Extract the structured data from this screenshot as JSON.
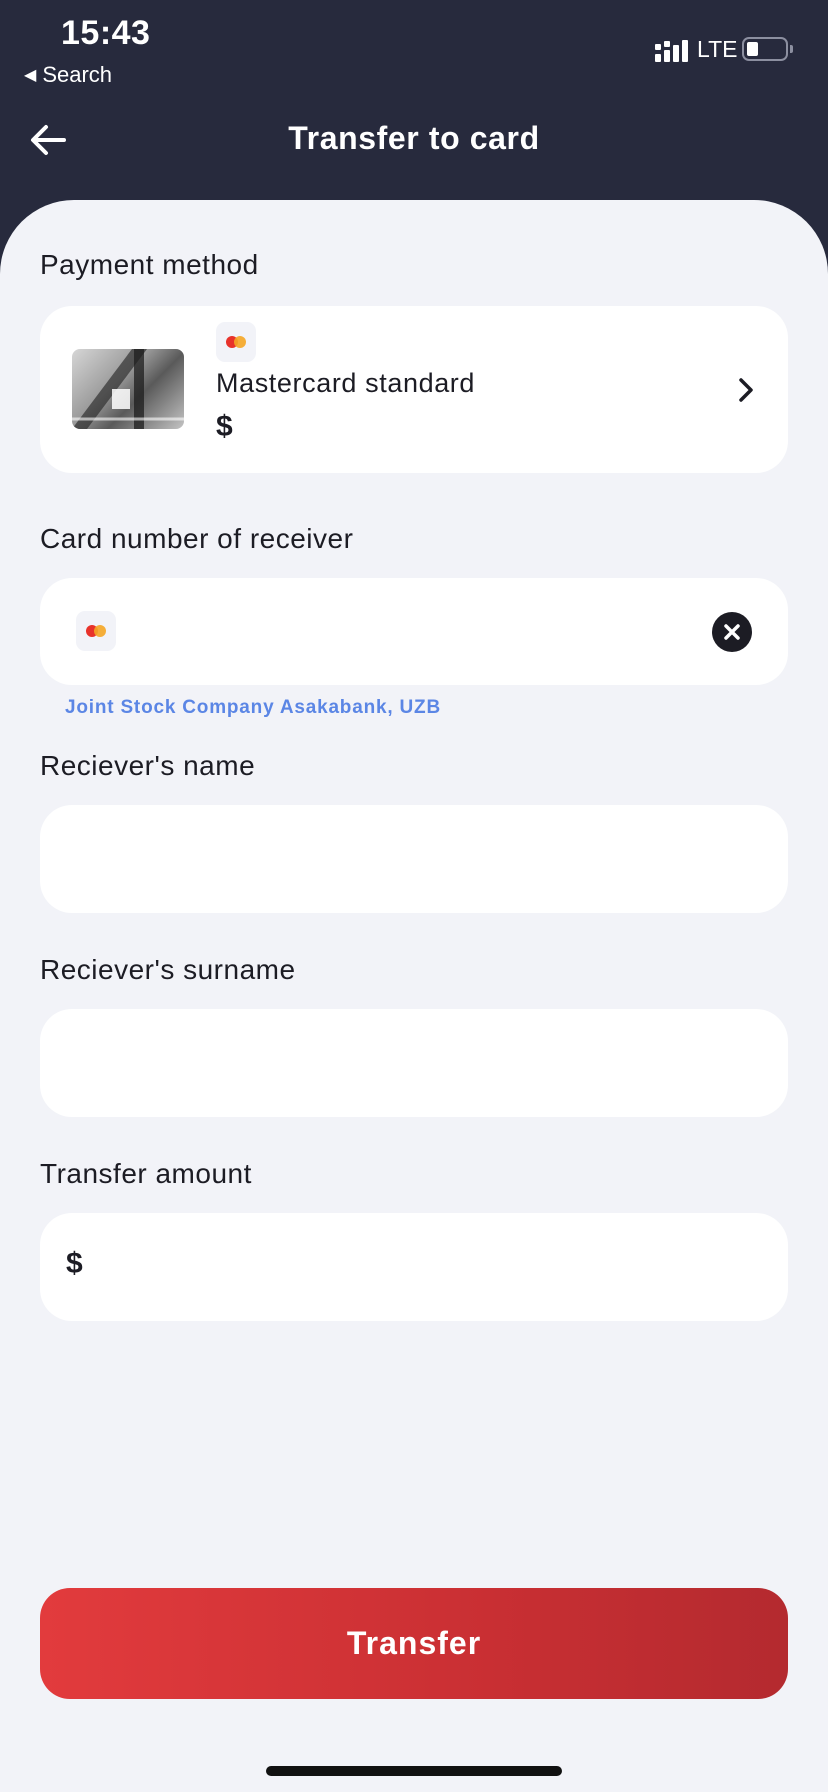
{
  "status_bar": {
    "time": "15:43",
    "back_app": "Search",
    "network": "LTE",
    "battery_level": 0.2
  },
  "header": {
    "title": "Transfer to card"
  },
  "payment_method": {
    "label": "Payment method",
    "card_name": "Mastercard standard",
    "currency": "$",
    "brand_icon": "mastercard-icon"
  },
  "receiver_card": {
    "label": "Card number of receiver",
    "value": "",
    "bank": "Joint Stock Company Asakabank, UZB"
  },
  "receiver_name": {
    "label": "Reciever's name",
    "value": ""
  },
  "receiver_surname": {
    "label": "Reciever's surname",
    "value": ""
  },
  "amount": {
    "label": "Transfer amount",
    "currency": "$",
    "value": ""
  },
  "actions": {
    "transfer_label": "Transfer"
  },
  "colors": {
    "header_bg": "#272a3d",
    "sheet_bg": "#f2f3f8",
    "accent": "#e23b3d",
    "link": "#5b86e5"
  }
}
